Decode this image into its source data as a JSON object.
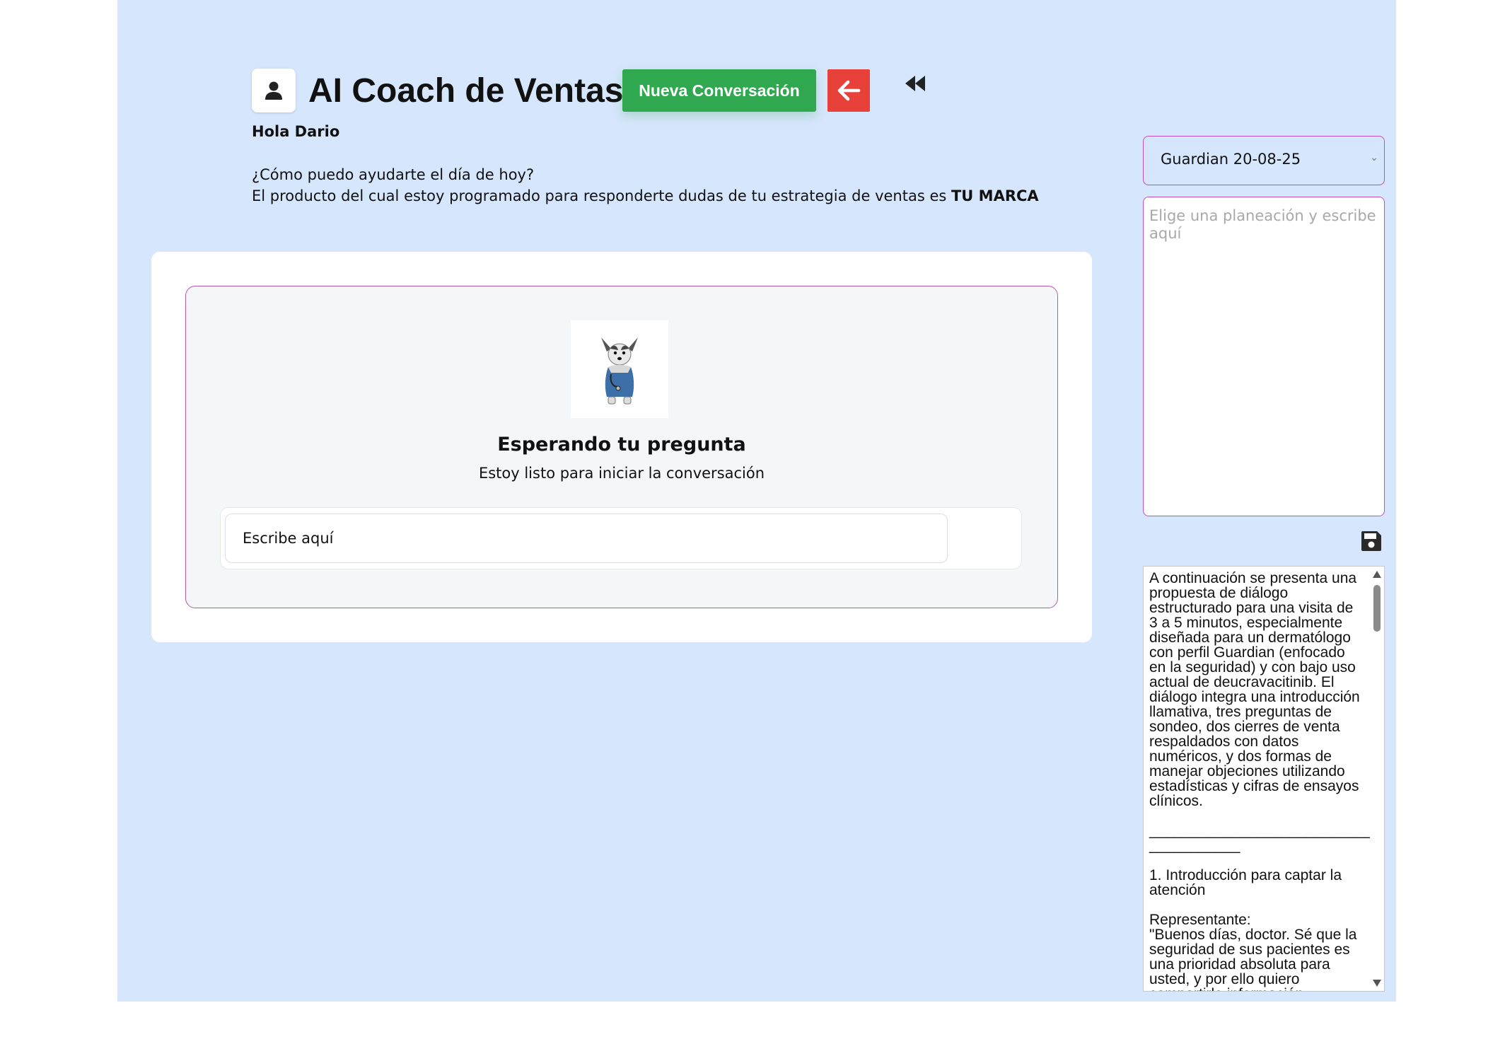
{
  "header": {
    "title": "AI Coach de Ventas",
    "new_conversation_label": "Nueva Conversación",
    "back_icon": "arrow-left-icon",
    "rewind_icon": "rewind-icon",
    "avatar_icon": "user-icon"
  },
  "greeting": "Hola Dario",
  "intro": {
    "line1": "¿Cómo puedo ayudarte el día de hoy?",
    "line2": "El producto del cual estoy programado para responderte dudas de tu estrategia de ventas es ",
    "brand": "TU MARCA"
  },
  "chat": {
    "waiting_title": "Esperando tu pregunta",
    "waiting_subtitle": "Estoy listo para iniciar la conversación",
    "input_placeholder": "Escribe aquí"
  },
  "sidebar": {
    "plan_selected": "Guardian 20-08-25",
    "plan_placeholder": "Elige una planeación y escribe aquí",
    "save_icon": "save-icon",
    "result_text": "A continuación se presenta una propuesta de diálogo estructurado para una visita de 3 a 5 minutos, especialmente diseñada para un dermatólogo con perfil Guardian (enfocado en la seguridad) y con bajo uso actual de deucravacitinib. El diálogo integra una introducción llamativa, tres preguntas de sondeo, dos cierres de venta respaldados con datos numéricos, y dos formas de manejar objeciones utilizando estadísticas y cifras de ensayos clínicos.\n\n____________________________\n___________\n\n1. Introducción para captar la atención\n\nRepresentante:\n\"Buenos días, doctor. Sé que la seguridad de sus pacientes es una prioridad absoluta para usted, y por ello quiero compartirle información relevante."
  },
  "colors": {
    "app_background": "#d6e6fc",
    "primary_green": "#2fa84f",
    "danger_red": "#e8413a",
    "accent_border": "#c24fc2"
  }
}
